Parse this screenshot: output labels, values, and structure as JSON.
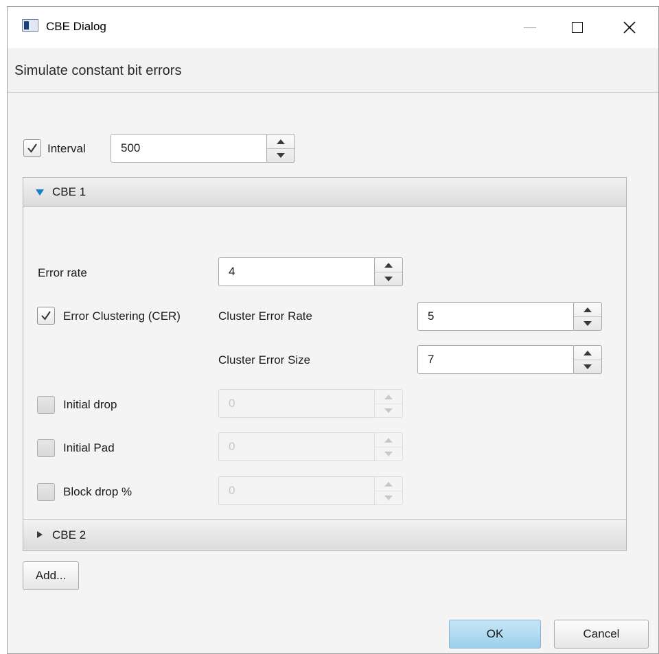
{
  "window": {
    "title": "CBE Dialog"
  },
  "header": {
    "text": "Simulate constant bit errors"
  },
  "interval": {
    "label": "Interval",
    "checked": true,
    "value": "500"
  },
  "panes": [
    {
      "title": "CBE 1",
      "expanded": true
    },
    {
      "title": "CBE 2",
      "expanded": false
    }
  ],
  "cbe1": {
    "error_rate": {
      "label": "Error rate",
      "value": "4"
    },
    "clustering": {
      "label": "Error Clustering (CER)",
      "checked": true
    },
    "cluster_rate": {
      "label": "Cluster Error Rate",
      "value": "5"
    },
    "cluster_size": {
      "label": "Cluster Error Size",
      "value": "7"
    },
    "initial_drop": {
      "label": "Initial drop",
      "checked": false,
      "value": "0"
    },
    "initial_pad": {
      "label": "Initial Pad",
      "checked": false,
      "value": "0"
    },
    "block_drop": {
      "label": "Block drop %",
      "checked": false,
      "value": "0"
    }
  },
  "buttons": {
    "add": "Add...",
    "ok": "OK",
    "cancel": "Cancel"
  },
  "colors": {
    "accent": "#0f7ec7",
    "default_button": "#a9d7f1"
  }
}
